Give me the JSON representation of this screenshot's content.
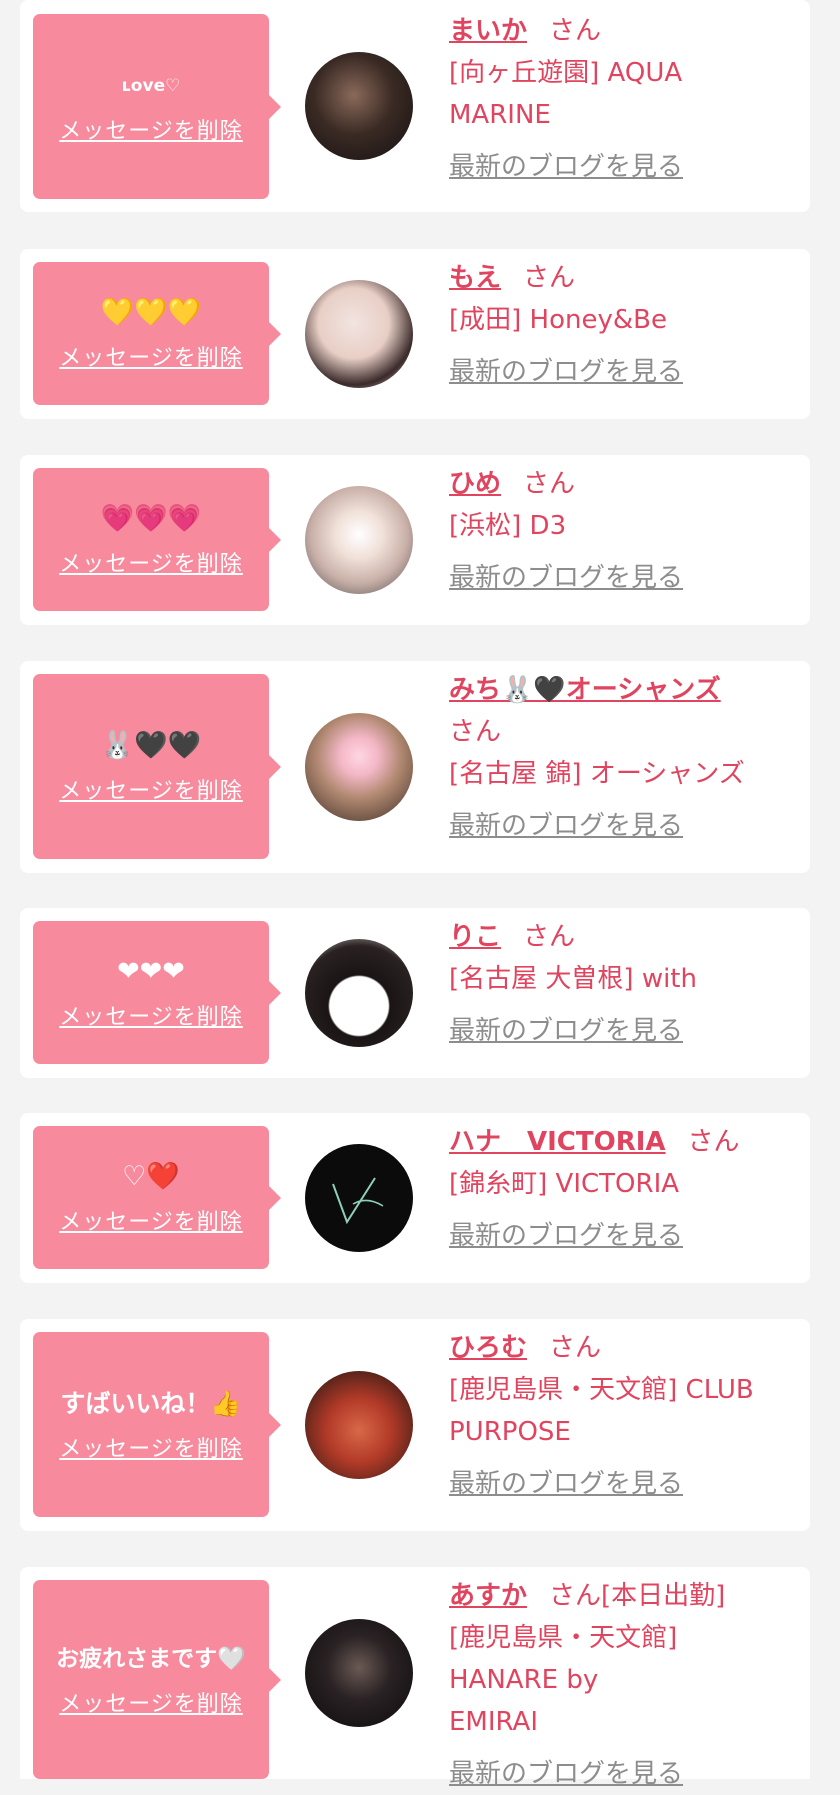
{
  "delete_label": "メッセージを削除",
  "san": "さん",
  "blog_link": "最新のブログを見る",
  "colors": {
    "accent": "#f78a9c",
    "name_text": "#e0445f",
    "link_gray": "#8d8d8d",
    "background": "#f3f3f3"
  },
  "items": [
    {
      "message": "ʟove♡",
      "name": "まいか",
      "shop": "[向ヶ丘遊園] AQUA MARINE",
      "note": ""
    },
    {
      "message": "💛💛💛",
      "name": "もえ",
      "shop": "[成田] Honey&Be",
      "note": ""
    },
    {
      "message": "💗💗💗",
      "name": "ひめ",
      "shop": "[浜松] D3",
      "note": ""
    },
    {
      "message": "🐰🖤🖤",
      "name": "みち🐰🖤オーシャンズ",
      "shop": "[名古屋 錦] オーシャンズ",
      "note": ""
    },
    {
      "message": "❤❤❤",
      "name": "りこ",
      "shop": "[名古屋 大曽根] with",
      "note": ""
    },
    {
      "message": "♡❤️",
      "name": "ハナ　VICTORIA",
      "shop": "[錦糸町] VICTORIA",
      "note": ""
    },
    {
      "message": "すばいいね！👍",
      "name": "ひろむ",
      "shop": "[鹿児島県・天文館] CLUB PURPOSE",
      "note": ""
    },
    {
      "message": "お疲れさまです🤍",
      "name": "あすか",
      "shop": "[鹿児島県・天文館] HANARE by EMIRAI",
      "note": "[本日出勤]"
    }
  ]
}
